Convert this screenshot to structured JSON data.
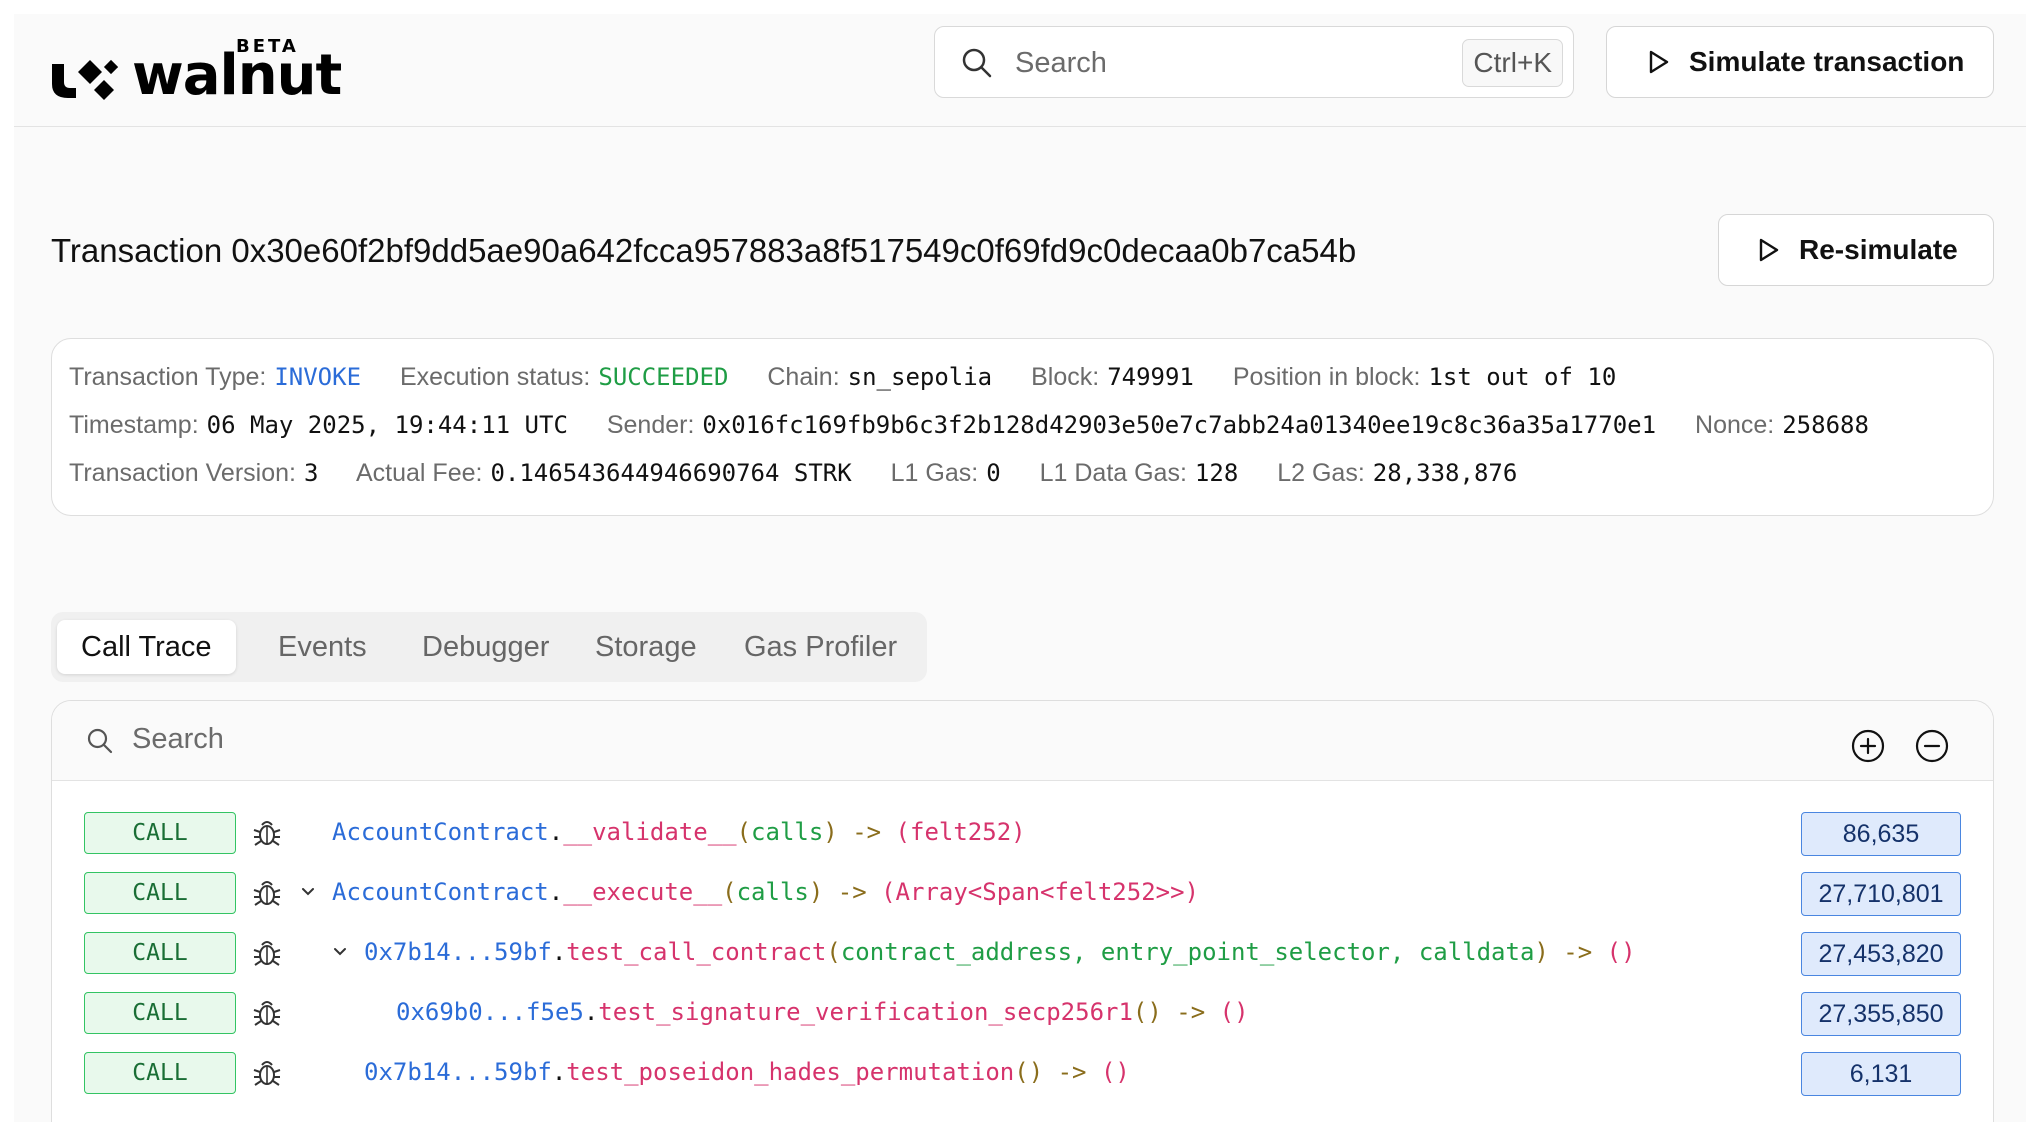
{
  "brand": {
    "name": "walnut",
    "tag": "BETA"
  },
  "header": {
    "search_placeholder": "Search",
    "search_shortcut": "Ctrl+K",
    "simulate_label": "Simulate transaction"
  },
  "transaction": {
    "title": "Transaction 0x30e60f2bf9dd5ae90a642fcca957883a8f517549c0f69fd9c0decaa0b7ca54b",
    "resimulate_label": "Re-simulate",
    "info": {
      "type_label": "Transaction Type:",
      "type_value": "INVOKE",
      "status_label": "Execution status:",
      "status_value": "SUCCEEDED",
      "chain_label": "Chain:",
      "chain_value": "sn_sepolia",
      "block_label": "Block:",
      "block_value": "749991",
      "position_label": "Position in block:",
      "position_value": "1st out of 10",
      "timestamp_label": "Timestamp:",
      "timestamp_value": "06 May 2025, 19:44:11 UTC",
      "sender_label": "Sender:",
      "sender_value": "0x016fc169fb9b6c3f2b128d42903e50e7c7abb24a01340ee19c8c36a35a1770e1",
      "nonce_label": "Nonce:",
      "nonce_value": "258688",
      "version_label": "Transaction Version:",
      "version_value": "3",
      "fee_label": "Actual Fee:",
      "fee_value": "0.146543644946690764 STRK",
      "l1gas_label": "L1 Gas:",
      "l1gas_value": "0",
      "l1data_label": "L1 Data Gas:",
      "l1data_value": "128",
      "l2gas_label": "L2 Gas:",
      "l2gas_value": "28,338,876"
    }
  },
  "tabs": [
    "Call Trace",
    "Events",
    "Debugger",
    "Storage",
    "Gas Profiler"
  ],
  "active_tab": "Call Trace",
  "trace": {
    "search_placeholder": "Search",
    "rows": [
      {
        "kind": "CALL",
        "contract": "AccountContract",
        "function": "__validate__",
        "params": "calls",
        "returns": "(felt252)",
        "gas": "86,635"
      },
      {
        "kind": "CALL",
        "contract": "AccountContract",
        "function": "__execute__",
        "params": "calls",
        "returns": "(Array<Span<felt252>>)",
        "gas": "27,710,801"
      },
      {
        "kind": "CALL",
        "contract": "0x7b14...59bf",
        "function": "test_call_contract",
        "params": "contract_address, entry_point_selector, calldata",
        "returns": "()",
        "gas": "27,453,820"
      },
      {
        "kind": "CALL",
        "contract": "0x69b0...f5e5",
        "function": "test_signature_verification_secp256r1",
        "params": "",
        "returns": "()",
        "gas": "27,355,850"
      },
      {
        "kind": "CALL",
        "contract": "0x7b14...59bf",
        "function": "test_poseidon_hades_permutation",
        "params": "",
        "returns": "()",
        "gas": "6,131"
      }
    ]
  },
  "colors": {
    "invoke": "#2b6cd8",
    "succeeded": "#1f9d45",
    "call_badge": "#33c463",
    "gas_badge": "#4a86e0",
    "function": "#d6336c"
  }
}
